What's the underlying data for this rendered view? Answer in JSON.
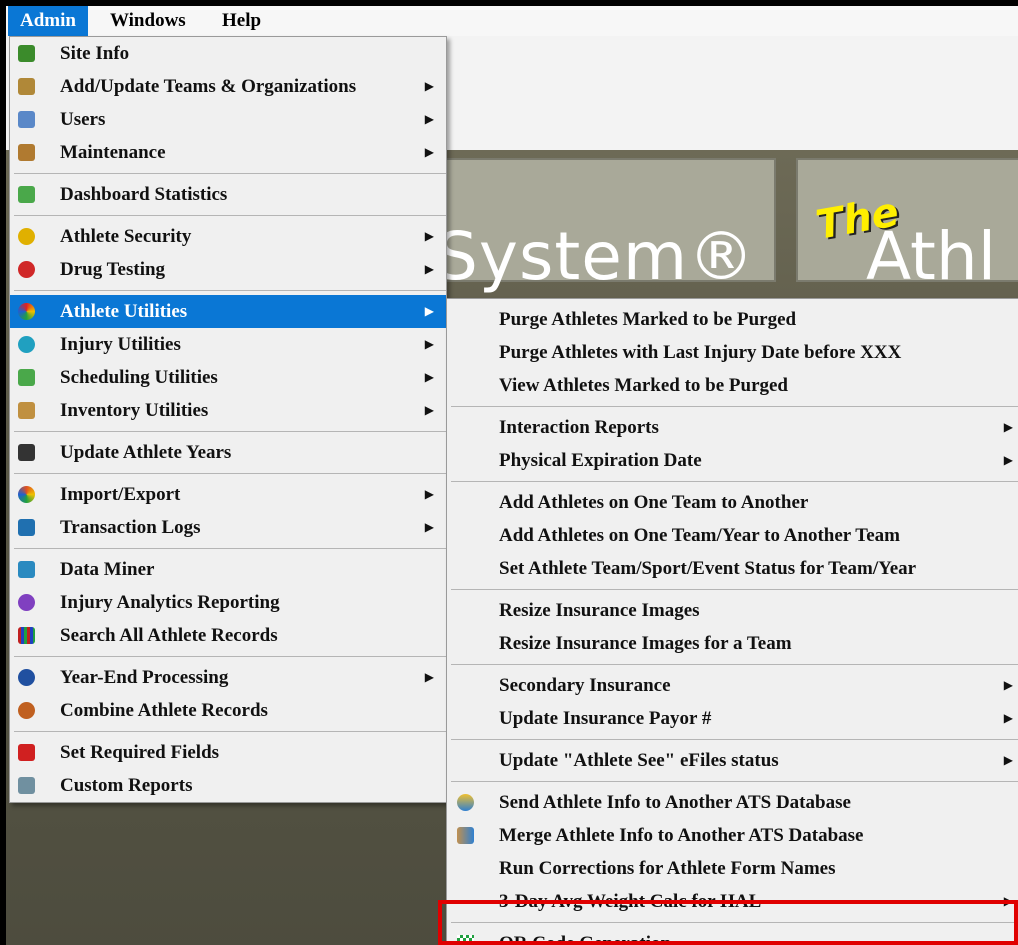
{
  "menubar": {
    "admin": "Admin",
    "windows": "Windows",
    "help": "Help"
  },
  "banner": {
    "the": "The",
    "system": "System®",
    "athl": "Athl"
  },
  "admin_menu": {
    "items": [
      {
        "label": "Site Info",
        "icon": "site-info-icon",
        "color": "#3b8b2b",
        "arrow": false
      },
      {
        "label": "Add/Update Teams & Organizations",
        "icon": "teams-icon",
        "color": "#b08838",
        "arrow": true
      },
      {
        "label": "Users",
        "icon": "users-icon",
        "color": "#5a88c8",
        "arrow": true
      },
      {
        "label": "Maintenance",
        "icon": "maintenance-icon",
        "color": "#b07a30",
        "arrow": true
      },
      {
        "label": "Dashboard Statistics",
        "icon": "dashboard-icon",
        "color": "#4aa84a",
        "arrow": false
      },
      {
        "label": "Athlete Security",
        "icon": "security-icon",
        "color": "#e0b000",
        "arrow": true
      },
      {
        "label": "Drug Testing",
        "icon": "drug-testing-icon",
        "color": "#d02828",
        "arrow": true
      },
      {
        "label": "Athlete Utilities",
        "icon": "athlete-utilities-icon",
        "color": "#e04090",
        "arrow": true
      },
      {
        "label": "Injury Utilities",
        "icon": "injury-utilities-icon",
        "color": "#20a0c0",
        "arrow": true
      },
      {
        "label": "Scheduling Utilities",
        "icon": "scheduling-icon",
        "color": "#4aa84a",
        "arrow": true
      },
      {
        "label": "Inventory Utilities",
        "icon": "inventory-icon",
        "color": "#c09040",
        "arrow": true
      },
      {
        "label": "Update Athlete Years",
        "icon": "graduate-icon",
        "color": "#333333",
        "arrow": false
      },
      {
        "label": "Import/Export",
        "icon": "import-export-icon",
        "color": "#e05020",
        "arrow": true
      },
      {
        "label": "Transaction Logs",
        "icon": "transaction-logs-icon",
        "color": "#2070b0",
        "arrow": true
      },
      {
        "label": "Data Miner",
        "icon": "data-miner-icon",
        "color": "#2a8ac0",
        "arrow": false
      },
      {
        "label": "Injury Analytics Reporting",
        "icon": "analytics-icon",
        "color": "#8040c0",
        "arrow": false
      },
      {
        "label": "Search All Athlete Records",
        "icon": "search-records-icon",
        "color": "#c02020",
        "arrow": false
      },
      {
        "label": "Year-End Processing",
        "icon": "year-end-icon",
        "color": "#2050a0",
        "arrow": true
      },
      {
        "label": "Combine Athlete Records",
        "icon": "combine-icon",
        "color": "#c06020",
        "arrow": false
      },
      {
        "label": "Set Required Fields",
        "icon": "required-fields-icon",
        "color": "#d02020",
        "arrow": false
      },
      {
        "label": "Custom Reports",
        "icon": "custom-reports-icon",
        "color": "#7090a0",
        "arrow": false
      }
    ]
  },
  "sub_menu": {
    "items": [
      {
        "label": "Purge Athletes Marked to be Purged",
        "arrow": false
      },
      {
        "label": "Purge Athletes with Last Injury Date before XXX",
        "arrow": false
      },
      {
        "label": "View Athletes Marked to be Purged",
        "arrow": false
      },
      {
        "label": "Interaction Reports",
        "arrow": true
      },
      {
        "label": "Physical Expiration Date",
        "arrow": true
      },
      {
        "label": "Add Athletes on One Team to Another",
        "arrow": false
      },
      {
        "label": "Add Athletes on One Team/Year to Another Team",
        "arrow": false
      },
      {
        "label": "Set Athlete Team/Sport/Event Status for Team/Year",
        "arrow": false
      },
      {
        "label": "Resize Insurance Images",
        "arrow": false
      },
      {
        "label": "Resize Insurance Images for a Team",
        "arrow": false
      },
      {
        "label": "Secondary Insurance",
        "arrow": true
      },
      {
        "label": "Update Insurance Payor #",
        "arrow": true
      },
      {
        "label": "Update \"Athlete See\" eFiles status",
        "arrow": true
      },
      {
        "label": "Send Athlete Info to Another ATS Database",
        "arrow": false,
        "icon": "send-db-icon"
      },
      {
        "label": "Merge Athlete Info to Another ATS Database",
        "arrow": false,
        "icon": "merge-db-icon"
      },
      {
        "label": "Run Corrections for Athlete Form Names",
        "arrow": false
      },
      {
        "label": "3-Day Avg Weight Calc for HAL",
        "arrow": true
      },
      {
        "label": "QR Code Generation",
        "arrow": false,
        "icon": "qr-code-icon"
      }
    ]
  },
  "colors": {
    "highlight": "#0a77d5",
    "callout": "#e00000"
  }
}
